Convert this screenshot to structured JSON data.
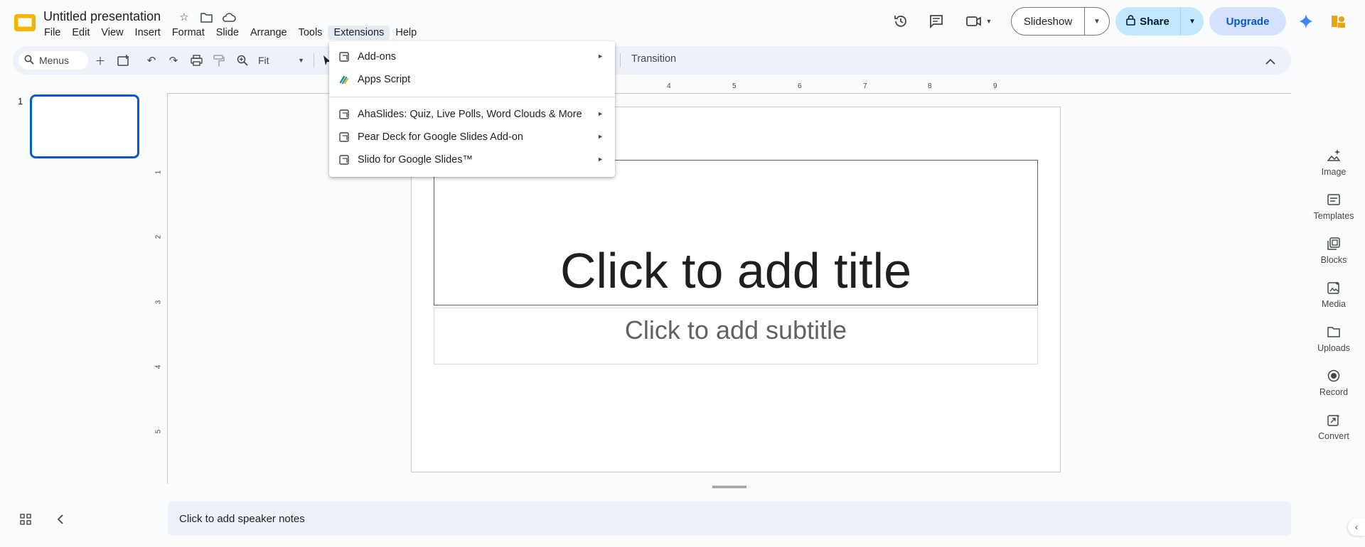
{
  "app": {
    "doc_title": "Untitled presentation",
    "logo_icon": "slides-logo-icon",
    "accent_color": "#0b57d0"
  },
  "menubar": {
    "items": [
      {
        "label": "File"
      },
      {
        "label": "Edit"
      },
      {
        "label": "View"
      },
      {
        "label": "Insert"
      },
      {
        "label": "Format"
      },
      {
        "label": "Slide"
      },
      {
        "label": "Arrange"
      },
      {
        "label": "Tools"
      },
      {
        "label": "Extensions",
        "active": true
      },
      {
        "label": "Help"
      }
    ]
  },
  "header_actions": {
    "slideshow_label": "Slideshow",
    "share_label": "Share",
    "upgrade_label": "Upgrade"
  },
  "toolbar": {
    "search_placeholder": "Menus",
    "zoom_value": "Fit",
    "transition_label": "Transition"
  },
  "extensions_menu": {
    "items": [
      {
        "label": "Add-ons",
        "icon": "addon-icon",
        "submenu": true
      },
      {
        "label": "Apps Script",
        "icon": "apps-script-icon",
        "submenu": false
      },
      {
        "label": "AhaSlides: Quiz, Live Polls, Word Clouds & More",
        "icon": "addon-icon",
        "submenu": true
      },
      {
        "label": "Pear Deck for Google Slides Add-on",
        "icon": "addon-icon",
        "submenu": true
      },
      {
        "label": "Slido for Google Slides™",
        "icon": "addon-icon",
        "submenu": true
      }
    ]
  },
  "filmstrip": {
    "slide_number": "1"
  },
  "ruler": {
    "h_labels": [
      "4",
      "5",
      "6",
      "7",
      "8",
      "9"
    ],
    "v_labels": [
      "1",
      "2",
      "3",
      "4",
      "5"
    ]
  },
  "slide": {
    "title_placeholder": "Click to add title",
    "subtitle_placeholder": "Click to add subtitle"
  },
  "notes": {
    "placeholder": "Click to add speaker notes"
  },
  "side_panel": {
    "items": [
      {
        "label": "Image",
        "icon": "image-sparkle-icon"
      },
      {
        "label": "Templates",
        "icon": "templates-icon"
      },
      {
        "label": "Blocks",
        "icon": "blocks-icon"
      },
      {
        "label": "Media",
        "icon": "media-icon"
      },
      {
        "label": "Uploads",
        "icon": "folder-icon"
      },
      {
        "label": "Record",
        "icon": "record-icon"
      },
      {
        "label": "Convert",
        "icon": "convert-icon"
      }
    ]
  }
}
